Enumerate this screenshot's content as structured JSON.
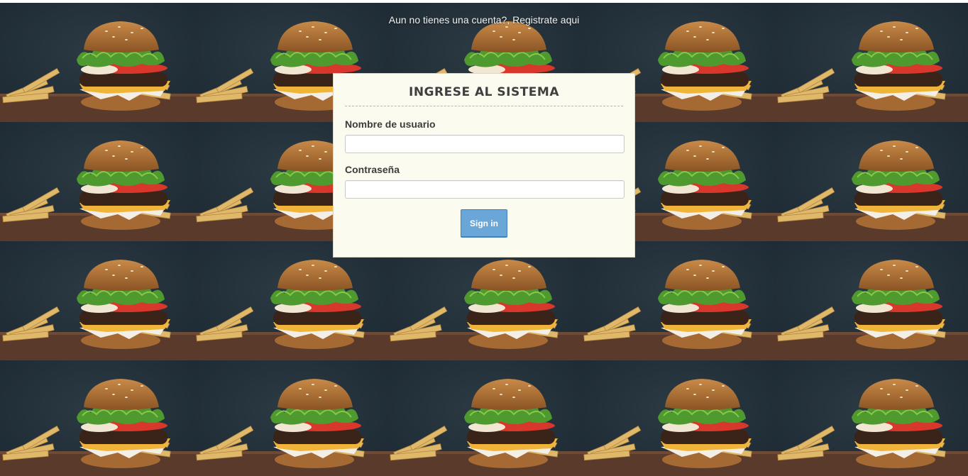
{
  "register_link": "Aun no tienes una cuenta?, Registrate aqui",
  "login": {
    "title": "INGRESE AL SISTEMA",
    "username_label": "Nombre de usuario",
    "username_value": "",
    "password_label": "Contraseña",
    "password_value": "",
    "submit_label": "Sign in"
  },
  "background": {
    "image": "burger-and-fries-photo",
    "tiling": "repeated grid",
    "colors": {
      "backdrop": "#1d2a33",
      "table": "#5a3a2b",
      "bun": "#b9783a",
      "lettuce": "#4f9a2e",
      "tomato": "#d8372b",
      "cheese": "#f1b43a",
      "patty": "#3a241a",
      "fries": "#e0b86a"
    }
  },
  "colors": {
    "panel_bg": "#fcfbf0",
    "button_bg": "#6aa6d7",
    "title_text": "#3f3f3f"
  }
}
